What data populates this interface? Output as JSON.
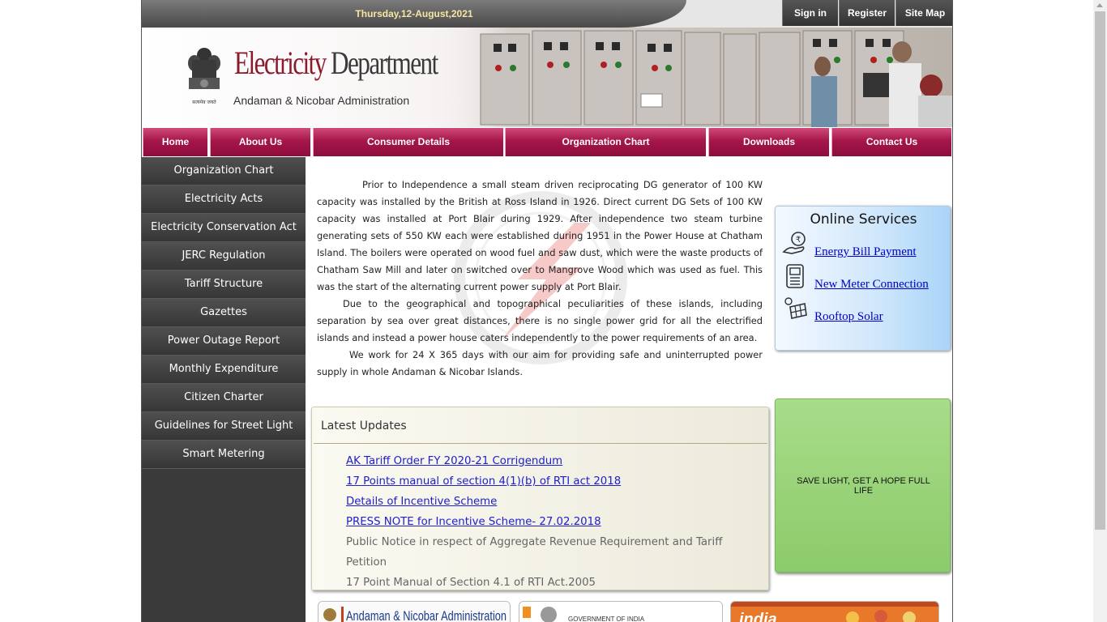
{
  "topbar": {
    "date": "Thursday,12-August,2021",
    "links": [
      "Sign in",
      "Register",
      "Site Map"
    ]
  },
  "banner": {
    "title_red": "Electricity",
    "title_dark": " Department",
    "subtitle": "Andaman & Nicobar Administration",
    "emblem_motto": "सत्यमेव जयते"
  },
  "nav": [
    "Home",
    "About Us",
    "Consumer Details",
    "Organization Chart",
    "Downloads",
    "Contact Us"
  ],
  "sidebar": [
    "Organization Chart",
    "Electricity Acts",
    "Electricity Conservation Act",
    "JERC Regulation",
    "Tariff Structure",
    "Gazettes",
    "Power Outage Report",
    "Monthly Expenditure",
    "Citizen Charter",
    "Guidelines for Street Light",
    "Smart Metering"
  ],
  "intro": {
    "p1": "Prior to Independence a small steam driven reciprocating DG generator of 100 KW capacity was installed by the British at Ross Island in 1926.  Direct current DG Sets of 100 KW capacity was installed at Port Blair during 1929. After independence two steam turbine generating sets of 550 KW each were established during 1951 in the Power House at Chatham Island.  The boilers were operated on wood fuel and saw dust, which were the waste products of Chatham Saw Mill and later on switched over to Mangrove Wood which was used as fuel. This was the start of the alternating current power supply at Port Blair.",
    "p2": "Due to the geographical and topographical peculiarities of these islands, including separation by sea over great distances, there is no single power grid for all the electrified islands and instead a power house caters independently to the power requirements of an area.",
    "p3": "We work for 24 X 365 days with our aim for providing safe and uninterrupted power supply in whole Andaman & Nicobar Islands."
  },
  "online_services": {
    "title": "Online Services",
    "items": [
      {
        "label": "Energy Bill Payment",
        "icon": "bill-payment-icon"
      },
      {
        "label": "New Meter Connection",
        "icon": "meter-icon"
      },
      {
        "label": "Rooftop Solar",
        "icon": "solar-panel-icon"
      }
    ]
  },
  "latest_updates": {
    "title": "Latest Updates",
    "items": [
      {
        "text": "AK Tariff Order FY 2020-21 Corrigendum",
        "link": true
      },
      {
        "text": "17 Points manual of section 4(1)(b) of RTI act 2018",
        "link": true
      },
      {
        "text": "Details of Incentive Scheme",
        "link": true
      },
      {
        "text": "PRESS NOTE for Incentive Scheme- 27.02.2018",
        "link": true
      },
      {
        "text": "Public Notice in respect of Aggregate Revenue Requirement and Tariff Petition",
        "link": false
      },
      {
        "text": "17 Point Manual of Section 4.1 of RTI Act.2005",
        "link": false
      }
    ]
  },
  "green_box": {
    "text": "SAVE LIGHT, GET A HOPE FULL LIFE"
  },
  "footer_logos": {
    "an_admin": "Andaman & Nicobar Administration",
    "goi": "GOVERNMENT OF INDIA",
    "india_portal": "india"
  },
  "colors": {
    "nav_maroon": "#a5164a",
    "sidebar_dark": "#3a3a3a",
    "date_gold": "#f5e6a0",
    "title_red": "#8b1a2b",
    "link_blue": "#2020cc"
  }
}
